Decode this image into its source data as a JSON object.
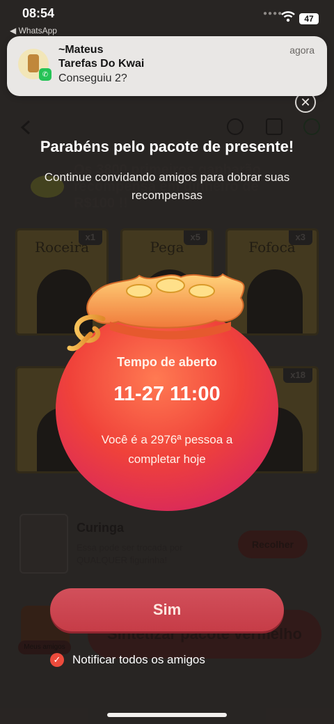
{
  "status_bar": {
    "time": "08:54",
    "back_app": "◀ WhatsApp",
    "battery": "47"
  },
  "notification": {
    "sender": "~Mateus",
    "group": "Tarefas Do Kwai",
    "message": "Conseguiu 2?",
    "time": "agora"
  },
  "background": {
    "banner_text": "Os 3800 primeiros ganharão recompensa em dinheiro de R$100 !!",
    "cards": [
      {
        "name": "Roceira",
        "badge": "x1"
      },
      {
        "name": "Pega",
        "badge": "x5"
      },
      {
        "name": "Fofoca",
        "badge": "x3"
      },
      {
        "name": "",
        "badge": ""
      },
      {
        "name": "",
        "badge": ""
      },
      {
        "name": "",
        "badge": "x18"
      }
    ],
    "joker_title": "Curinga",
    "joker_desc": "Essa pode ser trocada por QUALQUER figurinha!",
    "collect_label": "Recolher",
    "big_button": "Sintetizar pacote vermelho",
    "avatar_tag": "Meus amigos"
  },
  "modal": {
    "title": "Parabéns pelo pacote de presente!",
    "subtitle": "Continue convidando amigos para dobrar suas recompensas",
    "open_label": "Tempo de aberto",
    "open_time": "11-27 11:00",
    "rank_text": "Você é a 2976ª pessoa a completar hoje",
    "confirm_button": "Sim",
    "notify_label": "Notificar todos os amigos",
    "notify_checked": true
  },
  "colors": {
    "bag_main": "#f04a3a",
    "bag_top": "#f2a24b",
    "button": "#cc4450",
    "check": "#ec4b3c"
  }
}
